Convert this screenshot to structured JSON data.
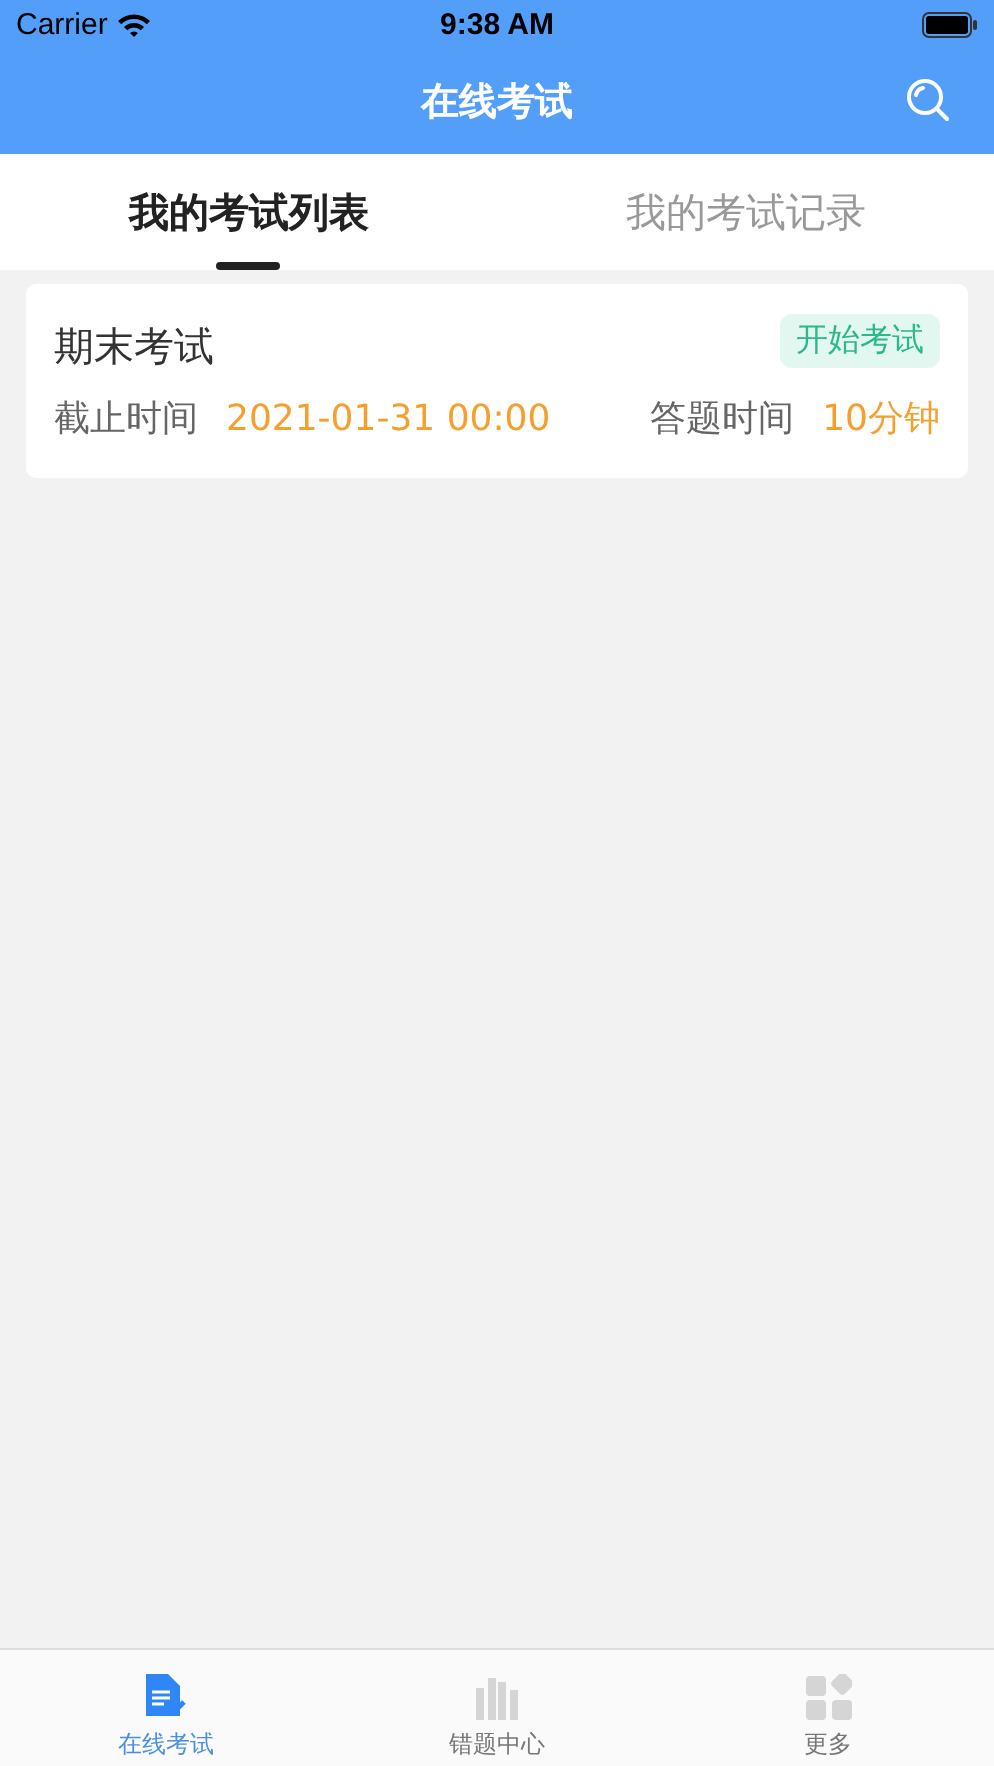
{
  "status_bar": {
    "carrier": "Carrier",
    "time": "9:38 AM"
  },
  "nav": {
    "title": "在线考试"
  },
  "tabs": [
    {
      "label": "我的考试列表",
      "selected": true
    },
    {
      "label": "我的考试记录",
      "selected": false
    }
  ],
  "exams": [
    {
      "title": "期末考试",
      "action": "开始考试",
      "deadline_label": "截止时间",
      "deadline": "2021-01-31 00:00",
      "duration_label": "答题时间",
      "duration": "10分钟"
    }
  ],
  "tab_bar": [
    {
      "kind": "document",
      "label": "在线考试",
      "selected": true
    },
    {
      "kind": "books",
      "label": "错题中心",
      "selected": false
    },
    {
      "kind": "grid",
      "label": "更多",
      "selected": false
    }
  ]
}
